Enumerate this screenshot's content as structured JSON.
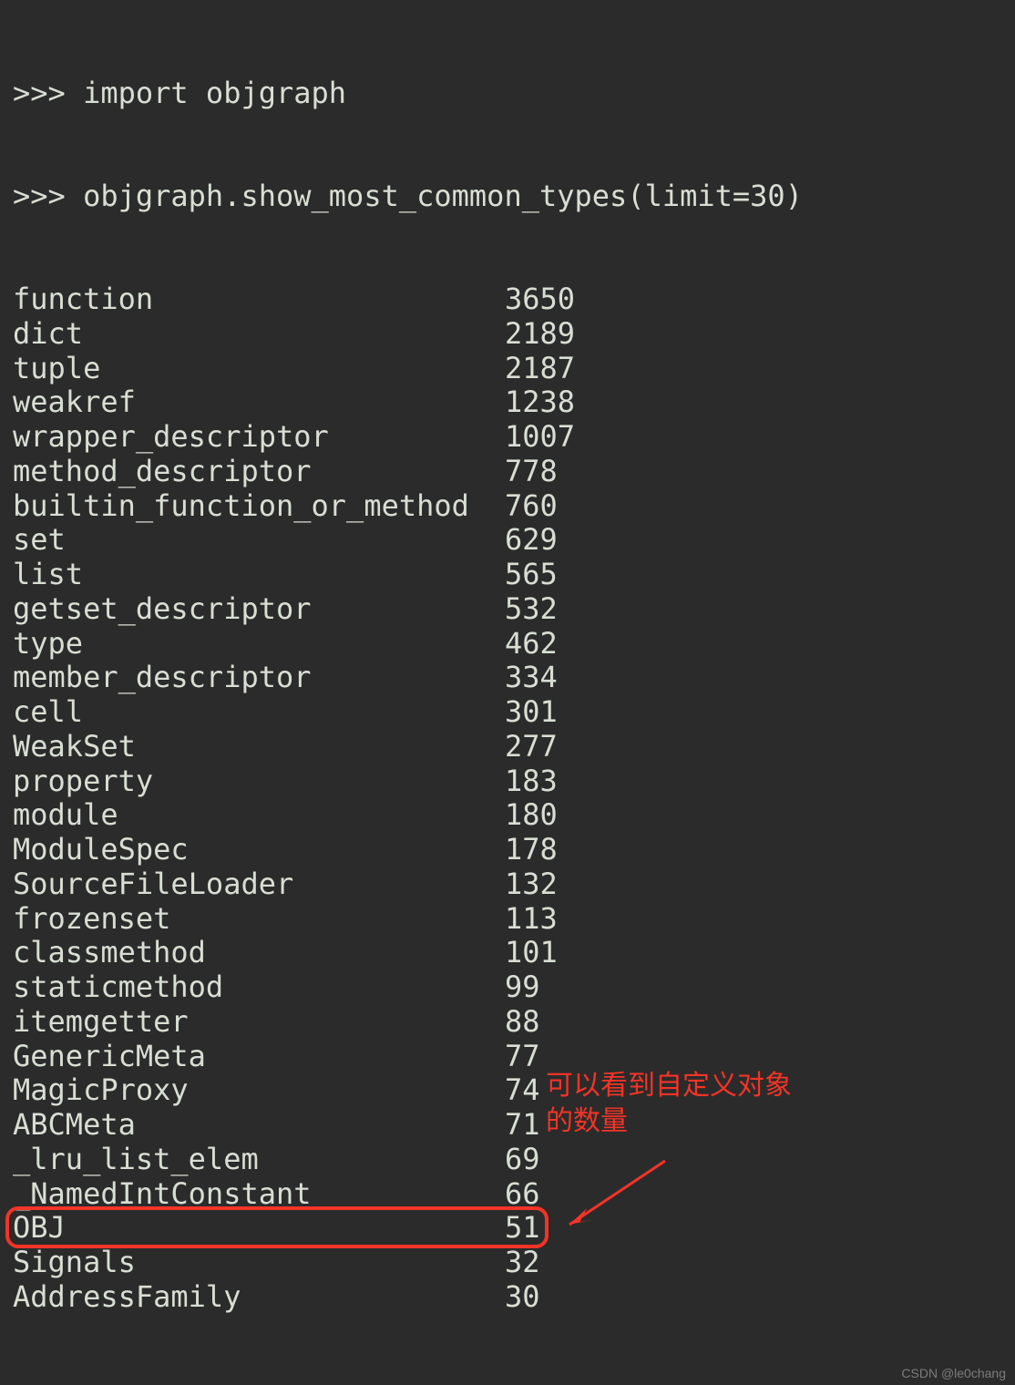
{
  "prompt": ">>> ",
  "lines": {
    "import": "import objgraph",
    "call": "objgraph.show_most_common_types(limit=30)"
  },
  "rows": [
    {
      "name": "function",
      "count": "3650"
    },
    {
      "name": "dict",
      "count": "2189"
    },
    {
      "name": "tuple",
      "count": "2187"
    },
    {
      "name": "weakref",
      "count": "1238"
    },
    {
      "name": "wrapper_descriptor",
      "count": "1007"
    },
    {
      "name": "method_descriptor",
      "count": "778"
    },
    {
      "name": "builtin_function_or_method",
      "count": "760"
    },
    {
      "name": "set",
      "count": "629"
    },
    {
      "name": "list",
      "count": "565"
    },
    {
      "name": "getset_descriptor",
      "count": "532"
    },
    {
      "name": "type",
      "count": "462"
    },
    {
      "name": "member_descriptor",
      "count": "334"
    },
    {
      "name": "cell",
      "count": "301"
    },
    {
      "name": "WeakSet",
      "count": "277"
    },
    {
      "name": "property",
      "count": "183"
    },
    {
      "name": "module",
      "count": "180"
    },
    {
      "name": "ModuleSpec",
      "count": "178"
    },
    {
      "name": "SourceFileLoader",
      "count": "132"
    },
    {
      "name": "frozenset",
      "count": "113"
    },
    {
      "name": "classmethod",
      "count": "101"
    },
    {
      "name": "staticmethod",
      "count": "99"
    },
    {
      "name": "itemgetter",
      "count": "88"
    },
    {
      "name": "GenericMeta",
      "count": "77"
    },
    {
      "name": "MagicProxy",
      "count": "74"
    },
    {
      "name": "ABCMeta",
      "count": "71"
    },
    {
      "name": "_lru_list_elem",
      "count": "69"
    },
    {
      "name": "_NamedIntConstant",
      "count": "66"
    },
    {
      "name": "OBJ",
      "count": "51"
    },
    {
      "name": "Signals",
      "count": "32"
    },
    {
      "name": "AddressFamily",
      "count": "30"
    }
  ],
  "annotation": {
    "line1": "可以看到自定义对象",
    "line2": "的数量"
  },
  "watermark": "CSDN @le0chang"
}
